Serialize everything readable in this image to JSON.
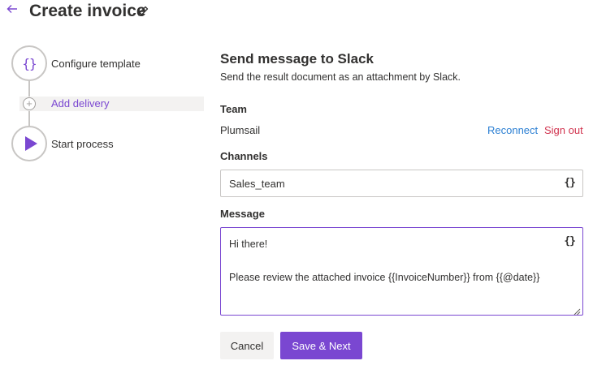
{
  "header": {
    "back_icon": "arrow-left-icon",
    "title": "Create invoice",
    "edit_icon": "pencil-icon"
  },
  "stepper": {
    "steps": [
      {
        "label": "Configure template",
        "icon": "braces-icon"
      },
      {
        "label": "Add delivery",
        "icon": "plus-circle-icon"
      },
      {
        "label": "Start process",
        "icon": "play-icon"
      }
    ]
  },
  "panel": {
    "title": "Send message to Slack",
    "description": "Send the result document as an attachment by Slack.",
    "team": {
      "label": "Team",
      "value": "Plumsail",
      "reconnect": "Reconnect",
      "sign_out": "Sign out"
    },
    "channels": {
      "label": "Channels",
      "value": "Sales_team",
      "insert_token_icon": "{}"
    },
    "message": {
      "label": "Message",
      "line1": "Hi there!",
      "line2": "Please review the attached invoice {{InvoiceNumber}} from {{@date}}",
      "insert_token_icon": "{}"
    }
  },
  "actions": {
    "cancel": "Cancel",
    "save_next": "Save & Next"
  },
  "colors": {
    "accent": "#7a47d1",
    "link": "#2b7fd3",
    "danger": "#d1344f",
    "text": "#323130",
    "border": "#c8c6c4"
  }
}
